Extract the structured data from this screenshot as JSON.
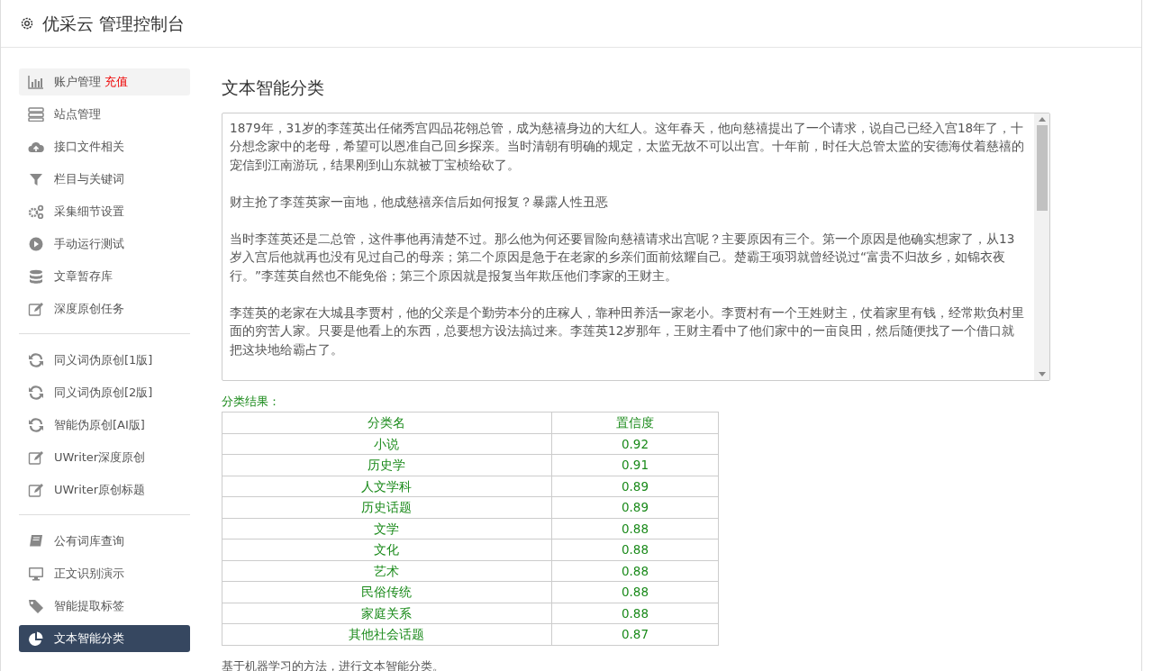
{
  "header": {
    "title": "优采云 管理控制台"
  },
  "sidebar": {
    "groups": [
      {
        "items": [
          {
            "label": "账户管理",
            "badge": "充值",
            "kind": "chart",
            "selected": false,
            "hovered": true
          },
          {
            "label": "站点管理",
            "kind": "server",
            "selected": false,
            "hovered": false
          },
          {
            "label": "接口文件相关",
            "kind": "cloud",
            "selected": false,
            "hovered": false
          },
          {
            "label": "栏目与关键词",
            "kind": "filter",
            "selected": false,
            "hovered": false
          },
          {
            "label": "采集细节设置",
            "kind": "gears",
            "selected": false,
            "hovered": false
          },
          {
            "label": "手动运行测试",
            "kind": "play",
            "selected": false,
            "hovered": false
          },
          {
            "label": "文章暂存库",
            "kind": "database",
            "selected": false,
            "hovered": false
          },
          {
            "label": "深度原创任务",
            "kind": "edit",
            "selected": false,
            "hovered": false
          }
        ]
      },
      {
        "items": [
          {
            "label": "同义词伪原创[1版]",
            "kind": "refresh",
            "selected": false,
            "hovered": false
          },
          {
            "label": "同义词伪原创[2版]",
            "kind": "refresh",
            "selected": false,
            "hovered": false
          },
          {
            "label": "智能伪原创[AI版]",
            "kind": "refresh",
            "selected": false,
            "hovered": false
          },
          {
            "label": "UWriter深度原创",
            "kind": "edit",
            "selected": false,
            "hovered": false
          },
          {
            "label": "UWriter原创标题",
            "kind": "edit",
            "selected": false,
            "hovered": false
          }
        ]
      },
      {
        "items": [
          {
            "label": "公有词库查询",
            "kind": "book",
            "selected": false,
            "hovered": false
          },
          {
            "label": "正文识别演示",
            "kind": "monitor",
            "selected": false,
            "hovered": false
          },
          {
            "label": "智能提取标签",
            "kind": "tag",
            "selected": false,
            "hovered": false
          },
          {
            "label": "文本智能分类",
            "kind": "pie",
            "selected": true,
            "hovered": false
          }
        ]
      }
    ]
  },
  "main": {
    "title": "文本智能分类",
    "text_input": {
      "paragraphs": [
        "1879年，31岁的李莲英出任储秀宫四品花翎总管，成为慈禧身边的大红人。这年春天，他向慈禧提出了一个请求，说自己已经入宫18年了，十分想念家中的老母，希望可以恩准自己回乡探亲。当时清朝有明确的规定，太监无故不可以出宫。十年前，时任大总管太监的安德海仗着慈禧的宠信到江南游玩，结果刚到山东就被丁宝桢给砍了。",
        "财主抢了李莲英家一亩地，他成慈禧亲信后如何报复？暴露人性丑恶",
        "当时李莲英还是二总管，这件事他再清楚不过。那么他为何还要冒险向慈禧请求出宫呢？主要原因有三个。第一个原因是他确实想家了，从13岁入宫后他就再也没有见过自己的母亲；第二个原因是急于在老家的乡亲们面前炫耀自己。楚霸王项羽就曾经说过“富贵不归故乡，如锦衣夜行。”李莲英自然也不能免俗；第三个原因就是报复当年欺压他们李家的王财主。",
        "李莲英的老家在大城县李贾村，他的父亲是个勤劳本分的庄稼人，靠种田养活一家老小。李贾村有一个王姓财主，仗着家里有钱，经常欺负村里面的穷苦人家。只要是他看上的东西，总要想方设法搞过来。李莲英12岁那年，王财主看中了他们家中的一亩良田，然后随便找了一个借口就把这块地给霸占了。"
      ]
    },
    "result_label": "分类结果：",
    "table": {
      "columns": [
        "分类名",
        "置信度"
      ],
      "rows": [
        [
          "小说",
          "0.92"
        ],
        [
          "历史学",
          "0.91"
        ],
        [
          "人文学科",
          "0.89"
        ],
        [
          "历史话题",
          "0.89"
        ],
        [
          "文学",
          "0.88"
        ],
        [
          "文化",
          "0.88"
        ],
        [
          "艺术",
          "0.88"
        ],
        [
          "民俗传统",
          "0.88"
        ],
        [
          "家庭关系",
          "0.88"
        ],
        [
          "其他社会话题",
          "0.87"
        ]
      ]
    },
    "note": "基于机器学习的方法，进行文本智能分类。"
  }
}
